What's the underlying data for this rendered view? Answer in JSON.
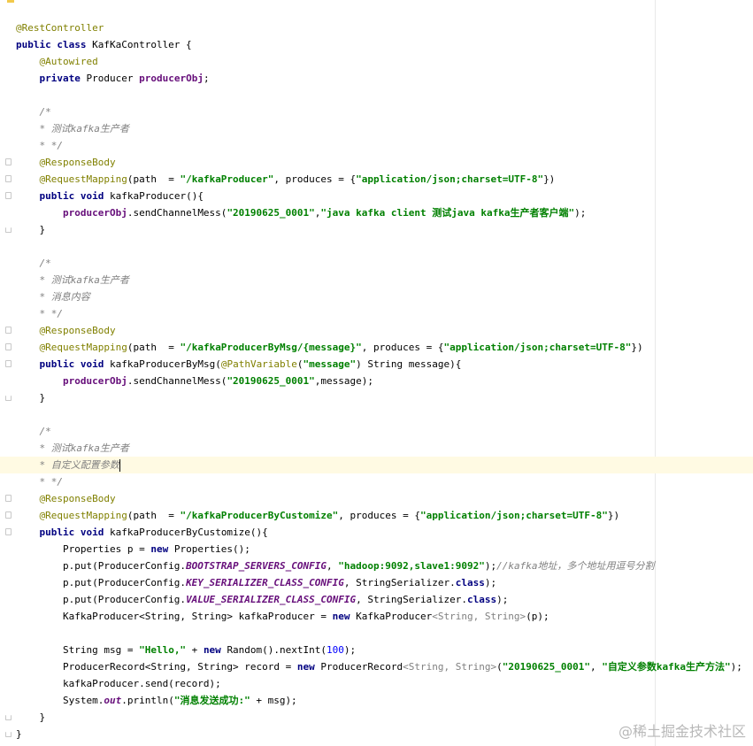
{
  "watermark": "@稀土掘金技术社区",
  "lines": [
    [
      {
        "t": "@RestController",
        "c": "ann"
      }
    ],
    [
      {
        "t": "public class ",
        "c": "kw"
      },
      {
        "t": "KafKaController {",
        "c": "ident"
      }
    ],
    [
      {
        "t": "    "
      },
      {
        "t": "@Autowired",
        "c": "ann"
      }
    ],
    [
      {
        "t": "    "
      },
      {
        "t": "private ",
        "c": "kw"
      },
      {
        "t": "Producer "
      },
      {
        "t": "producerObj",
        "c": "fld"
      },
      {
        "t": ";"
      }
    ],
    [],
    [
      {
        "t": "    "
      },
      {
        "t": "/*",
        "c": "cmt"
      }
    ],
    [
      {
        "t": "    "
      },
      {
        "t": "* 测试kafka生产者",
        "c": "cmt"
      }
    ],
    [
      {
        "t": "    "
      },
      {
        "t": "* */",
        "c": "cmt"
      }
    ],
    [
      {
        "t": "    "
      },
      {
        "t": "@ResponseBody",
        "c": "ann"
      }
    ],
    [
      {
        "t": "    "
      },
      {
        "t": "@RequestMapping",
        "c": "ann"
      },
      {
        "t": "(path  = "
      },
      {
        "t": "\"/kafkaProducer\"",
        "c": "str"
      },
      {
        "t": ", produces = {"
      },
      {
        "t": "\"application/json;charset=UTF-8\"",
        "c": "str"
      },
      {
        "t": "})"
      }
    ],
    [
      {
        "t": "    "
      },
      {
        "t": "public void ",
        "c": "kw"
      },
      {
        "t": "kafkaProducer(){"
      }
    ],
    [
      {
        "t": "        "
      },
      {
        "t": "producerObj",
        "c": "fld"
      },
      {
        "t": ".sendChannelMess("
      },
      {
        "t": "\"20190625_0001\"",
        "c": "str"
      },
      {
        "t": ","
      },
      {
        "t": "\"java kafka client 测试java kafka生产者客户端\"",
        "c": "str"
      },
      {
        "t": ");"
      }
    ],
    [
      {
        "t": "    }"
      }
    ],
    [],
    [
      {
        "t": "    "
      },
      {
        "t": "/*",
        "c": "cmt"
      }
    ],
    [
      {
        "t": "    "
      },
      {
        "t": "* 测试kafka生产者",
        "c": "cmt"
      }
    ],
    [
      {
        "t": "    "
      },
      {
        "t": "* 消息内容",
        "c": "cmt"
      }
    ],
    [
      {
        "t": "    "
      },
      {
        "t": "* */",
        "c": "cmt"
      }
    ],
    [
      {
        "t": "    "
      },
      {
        "t": "@ResponseBody",
        "c": "ann"
      }
    ],
    [
      {
        "t": "    "
      },
      {
        "t": "@RequestMapping",
        "c": "ann"
      },
      {
        "t": "(path  = "
      },
      {
        "t": "\"/kafkaProducerByMsg/{message}\"",
        "c": "str"
      },
      {
        "t": ", produces = {"
      },
      {
        "t": "\"application/json;charset=UTF-8\"",
        "c": "str"
      },
      {
        "t": "})"
      }
    ],
    [
      {
        "t": "    "
      },
      {
        "t": "public void ",
        "c": "kw"
      },
      {
        "t": "kafkaProducerByMsg("
      },
      {
        "t": "@PathVariable",
        "c": "ann"
      },
      {
        "t": "("
      },
      {
        "t": "\"message\"",
        "c": "str"
      },
      {
        "t": ") String message){"
      }
    ],
    [
      {
        "t": "        "
      },
      {
        "t": "producerObj",
        "c": "fld"
      },
      {
        "t": ".sendChannelMess("
      },
      {
        "t": "\"20190625_0001\"",
        "c": "str"
      },
      {
        "t": ",message);"
      }
    ],
    [
      {
        "t": "    }"
      }
    ],
    [],
    [
      {
        "t": "    "
      },
      {
        "t": "/*",
        "c": "cmt"
      }
    ],
    [
      {
        "t": "    "
      },
      {
        "t": "* 测试kafka生产者",
        "c": "cmt"
      }
    ],
    [
      {
        "t": "    "
      },
      {
        "t": "* 自定义配置参数",
        "c": "cmt"
      }
    ],
    [
      {
        "t": "    "
      },
      {
        "t": "* */",
        "c": "cmt"
      }
    ],
    [
      {
        "t": "    "
      },
      {
        "t": "@ResponseBody",
        "c": "ann"
      }
    ],
    [
      {
        "t": "    "
      },
      {
        "t": "@RequestMapping",
        "c": "ann"
      },
      {
        "t": "(path  = "
      },
      {
        "t": "\"/kafkaProducerByCustomize\"",
        "c": "str"
      },
      {
        "t": ", produces = {"
      },
      {
        "t": "\"application/json;charset=UTF-8\"",
        "c": "str"
      },
      {
        "t": "})"
      }
    ],
    [
      {
        "t": "    "
      },
      {
        "t": "public void ",
        "c": "kw"
      },
      {
        "t": "kafkaProducerByCustomize(){"
      }
    ],
    [
      {
        "t": "        Properties p = "
      },
      {
        "t": "new ",
        "c": "kw"
      },
      {
        "t": "Properties();"
      }
    ],
    [
      {
        "t": "        p.put(ProducerConfig."
      },
      {
        "t": "BOOTSTRAP_SERVERS_CONFIG",
        "c": "sfld"
      },
      {
        "t": ", "
      },
      {
        "t": "\"hadoop:9092,slave1:9092\"",
        "c": "str"
      },
      {
        "t": ");"
      },
      {
        "t": "//kafka地址，多个地址用逗号分割",
        "c": "cmt"
      }
    ],
    [
      {
        "t": "        p.put(ProducerConfig."
      },
      {
        "t": "KEY_SERIALIZER_CLASS_CONFIG",
        "c": "sfld"
      },
      {
        "t": ", StringSerializer."
      },
      {
        "t": "class",
        "c": "kw"
      },
      {
        "t": ");"
      }
    ],
    [
      {
        "t": "        p.put(ProducerConfig."
      },
      {
        "t": "VALUE_SERIALIZER_CLASS_CONFIG",
        "c": "sfld"
      },
      {
        "t": ", StringSerializer."
      },
      {
        "t": "class",
        "c": "kw"
      },
      {
        "t": ");"
      }
    ],
    [
      {
        "t": "        KafkaProducer<String, String> kafkaProducer = "
      },
      {
        "t": "new ",
        "c": "kw"
      },
      {
        "t": "KafkaProducer"
      },
      {
        "t": "<String, String>",
        "c": "gen"
      },
      {
        "t": "(p);"
      }
    ],
    [],
    [
      {
        "t": "        String msg = "
      },
      {
        "t": "\"Hello,\"",
        "c": "str"
      },
      {
        "t": " + "
      },
      {
        "t": "new ",
        "c": "kw"
      },
      {
        "t": "Random().nextInt("
      },
      {
        "t": "100",
        "c": "num"
      },
      {
        "t": ");"
      }
    ],
    [
      {
        "t": "        ProducerRecord<String, String> record = "
      },
      {
        "t": "new ",
        "c": "kw"
      },
      {
        "t": "ProducerRecord"
      },
      {
        "t": "<String, String>",
        "c": "gen"
      },
      {
        "t": "("
      },
      {
        "t": "\"20190625_0001\"",
        "c": "str"
      },
      {
        "t": ", "
      },
      {
        "t": "\"自定义参数kafka生产方法\"",
        "c": "str"
      },
      {
        "t": ");"
      }
    ],
    [
      {
        "t": "        kafkaProducer.send(record);"
      }
    ],
    [
      {
        "t": "        System."
      },
      {
        "t": "out",
        "c": "sfld"
      },
      {
        "t": ".println("
      },
      {
        "t": "\"消息发送成功:\"",
        "c": "str"
      },
      {
        "t": " + msg);"
      }
    ],
    [
      {
        "t": "    }"
      }
    ],
    [
      {
        "t": "}"
      }
    ]
  ]
}
